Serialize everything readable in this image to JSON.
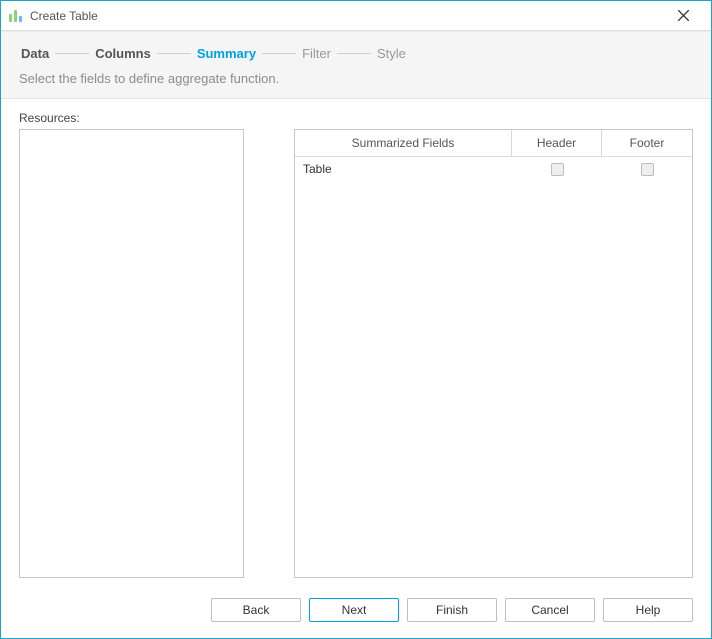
{
  "window": {
    "title": "Create Table"
  },
  "steps": {
    "data": "Data",
    "columns": "Columns",
    "summary": "Summary",
    "filter": "Filter",
    "style": "Style"
  },
  "subtitle": "Select the fields to define aggregate function.",
  "labels": {
    "resources": "Resources:"
  },
  "grid": {
    "columns": {
      "name": "Summarized Fields",
      "header": "Header",
      "footer": "Footer"
    },
    "rows": [
      {
        "name": "Table",
        "header": false,
        "footer": false
      }
    ]
  },
  "buttons": {
    "back": "Back",
    "next": "Next",
    "finish": "Finish",
    "cancel": "Cancel",
    "help": "Help"
  }
}
